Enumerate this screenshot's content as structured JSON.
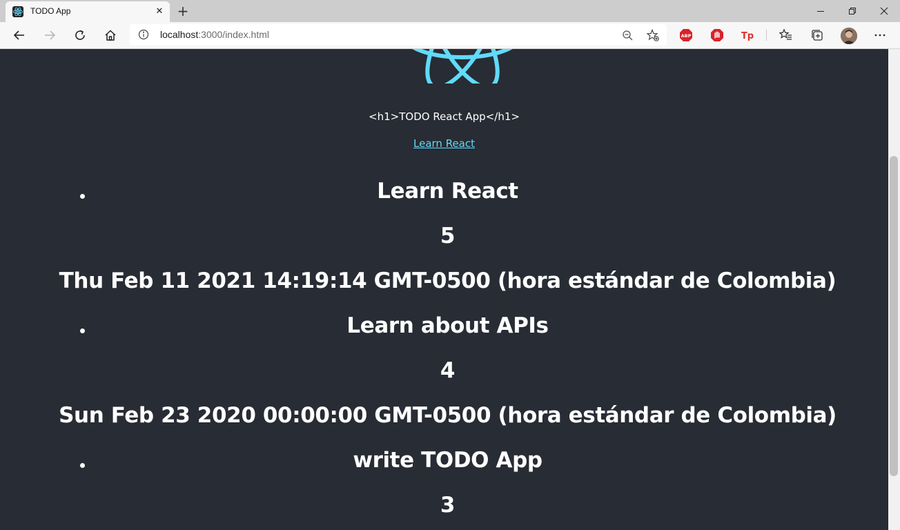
{
  "browser": {
    "tab_title": "TODO App",
    "tab_close": "✕",
    "new_tab": "+",
    "address_host": "localhost",
    "address_path": ":3000/index.html"
  },
  "page": {
    "h1_text": "<h1>TODO React App</h1>",
    "learn_link": "Learn React",
    "todos": [
      {
        "title": "Learn React",
        "priority": "5",
        "date": "Thu Feb 11 2021 14:19:14 GMT-0500 (hora estándar de Colombia)"
      },
      {
        "title": "Learn about APIs",
        "priority": "4",
        "date": "Sun Feb 23 2020 00:00:00 GMT-0500 (hora estándar de Colombia)"
      },
      {
        "title": "write TODO App",
        "priority": "3"
      }
    ]
  },
  "colors": {
    "page_bg": "#282c34",
    "link": "#61dafb",
    "text": "#ffffff"
  }
}
